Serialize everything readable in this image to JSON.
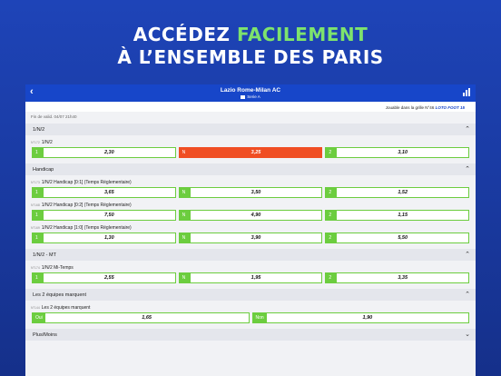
{
  "headline": {
    "line1_prefix": "ACCÉDEZ ",
    "line1_accent": "FACILEMENT",
    "line2": "À L’ENSEMBLE DES PARIS"
  },
  "appbar": {
    "title": "Lazio Rome-Milan AC",
    "subtitle": "Serie A",
    "back": "‹"
  },
  "promo": {
    "text": "Jouable dans la grille N°46 ",
    "brand": "LOTO FOOT 15"
  },
  "validity": "Fin de valid. 04/07 21h40",
  "sections": [
    {
      "title": "1/N/2",
      "markets": [
        {
          "code": "N°172",
          "label": "1/N/2",
          "odds": [
            {
              "tag": "1",
              "value": "2,30",
              "selected": false
            },
            {
              "tag": "N",
              "value": "3,25",
              "selected": true
            },
            {
              "tag": "2",
              "value": "3,10",
              "selected": false
            }
          ]
        }
      ]
    },
    {
      "title": "Handicap",
      "markets": [
        {
          "code": "N°173",
          "label": "1/N/2 Handicap [0:1] (Temps Réglementaire)",
          "odds": [
            {
              "tag": "1",
              "value": "3,65"
            },
            {
              "tag": "N",
              "value": "3,50"
            },
            {
              "tag": "2",
              "value": "1,52"
            }
          ]
        },
        {
          "code": "N°168",
          "label": "1/N/2 Handicap [0:2] (Temps Réglementaire)",
          "odds": [
            {
              "tag": "1",
              "value": "7,50"
            },
            {
              "tag": "N",
              "value": "4,90"
            },
            {
              "tag": "2",
              "value": "1,15"
            }
          ]
        },
        {
          "code": "N°169",
          "label": "1/N/2 Handicap [1:0] (Temps Réglementaire)",
          "odds": [
            {
              "tag": "1",
              "value": "1,30"
            },
            {
              "tag": "N",
              "value": "3,90"
            },
            {
              "tag": "2",
              "value": "5,50"
            }
          ]
        }
      ]
    },
    {
      "title": "1/N/2 - MT",
      "markets": [
        {
          "code": "N°174",
          "label": "1/N/2 Mi-Temps",
          "odds": [
            {
              "tag": "1",
              "value": "2,55"
            },
            {
              "tag": "N",
              "value": "1,95"
            },
            {
              "tag": "2",
              "value": "3,35"
            }
          ]
        }
      ]
    },
    {
      "title": "Les 2 équipes marquent",
      "markets": [
        {
          "code": "N°144",
          "label": "Les 2 équipes marquent",
          "odds": [
            {
              "tag": "Oui",
              "value": "1,65"
            },
            {
              "tag": "Non",
              "value": "1,90"
            }
          ]
        }
      ]
    },
    {
      "title": "Plus/Moins",
      "markets": []
    }
  ]
}
